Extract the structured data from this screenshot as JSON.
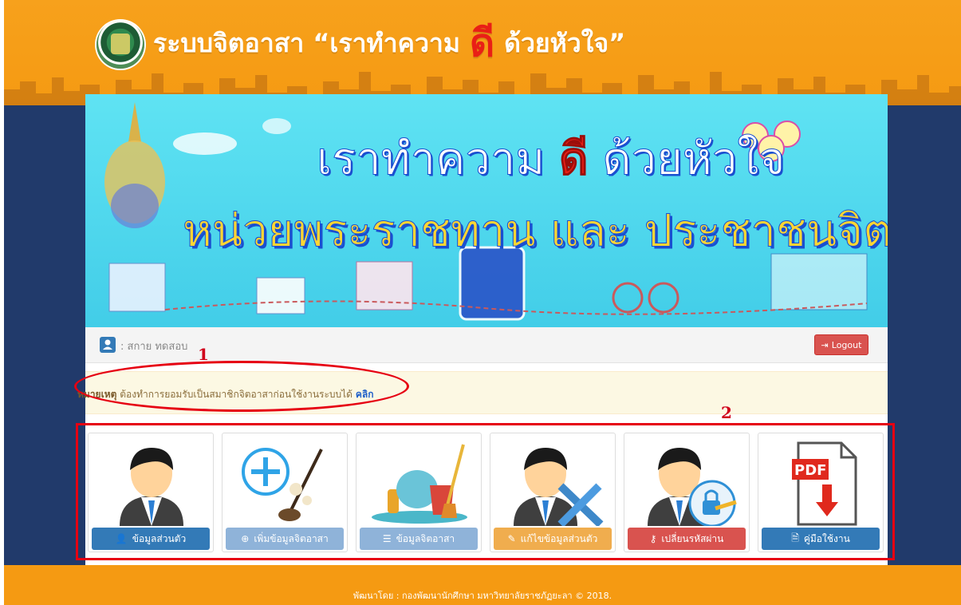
{
  "header": {
    "title_part1": "ระบบจิตอาสา “เราทำความ",
    "title_emphasis": "ดี",
    "title_part2": "ด้วยหัวใจ”"
  },
  "banner": {
    "line1_part1": "เราทำความ",
    "line1_emphasis": "ดี",
    "line1_part2": "ด้วยหัวใจ",
    "line2": "หน่วยพระราชทาน และ ประชาชนจิตอาสา"
  },
  "user_bar": {
    "user_name": ": สกาย ทดสอบ",
    "logout_label": "Logout"
  },
  "notice": {
    "label": "หมายเหตุ",
    "message": "ต้องทำการยอมรับเป็นสมาชิกจิตอาสาก่อนใช้งานระบบได้",
    "link_text": "คลิก"
  },
  "annotations": {
    "label_1": "1",
    "label_2": "2"
  },
  "menu": [
    {
      "label": "ข้อมูลส่วนตัว",
      "icon": "user-icon",
      "color": "#337ab7"
    },
    {
      "label": "เพิ่มข้อมูลจิตอาสา",
      "icon": "plus-circle-icon",
      "color": "#8fb3d9"
    },
    {
      "label": "ข้อมูลจิตอาสา",
      "icon": "list-icon",
      "color": "#8fb3d9"
    },
    {
      "label": "แก้ไขข้อมูลส่วนตัว",
      "icon": "edit-icon",
      "color": "#f0ad4e"
    },
    {
      "label": "เปลี่ยนรหัสผ่าน",
      "icon": "key-icon",
      "color": "#d9534f"
    },
    {
      "label": "คู่มือใช้งาน",
      "icon": "pdf-icon",
      "color": "#337ab7"
    }
  ],
  "footer": {
    "text": "พัฒนาโดย : กองพัฒนานักศึกษา มหาวิทยาลัยราชภัฏยะลา © 2018."
  },
  "colors": {
    "header_orange": "#f59a12",
    "navy": "#213a6b",
    "banner_cyan": "#4fd8ee",
    "annotation_red": "#e60012"
  }
}
